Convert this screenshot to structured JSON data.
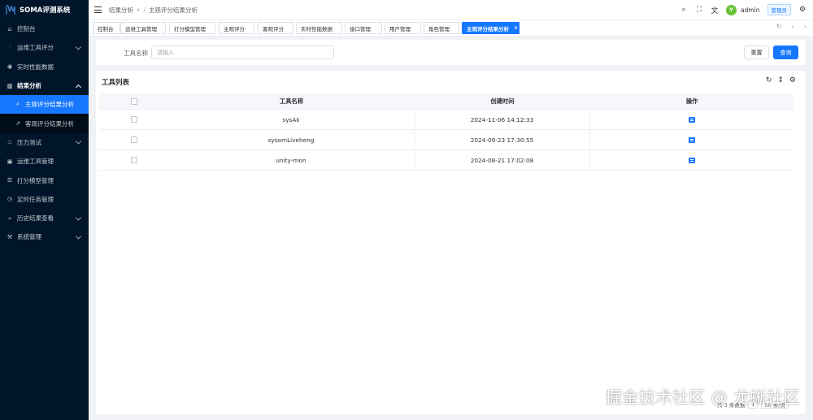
{
  "app": {
    "title": "SOMA评测系统"
  },
  "sidebar": {
    "items": [
      {
        "label": "控制台",
        "icon": "dashboard-icon"
      },
      {
        "label": "运维工具评分",
        "icon": "sliders-icon"
      },
      {
        "label": "实时性能数据",
        "icon": "gauge-icon"
      },
      {
        "label": "结果分析",
        "icon": "chart-icon"
      },
      {
        "label": "压力测试",
        "icon": "fire-icon"
      },
      {
        "label": "运维工具管理",
        "icon": "toolbox-icon"
      },
      {
        "label": "打分模型管理",
        "icon": "score-icon"
      },
      {
        "label": "定时任务管理",
        "icon": "clock-icon"
      },
      {
        "label": "历史结果查看",
        "icon": "history-icon"
      },
      {
        "label": "系统管理",
        "icon": "wrench-icon"
      }
    ],
    "submenu": [
      {
        "label": "主观评分结果分析",
        "icon": "search-doc-icon"
      },
      {
        "label": "客观评分结果分析",
        "icon": "trend-icon"
      }
    ]
  },
  "header": {
    "breadcrumb": [
      "结果分析",
      "主观评分结果分析"
    ],
    "username": "admin",
    "role": "管理员",
    "avatar_text": "Y"
  },
  "tabs": [
    "控制台",
    "运维工具管理",
    "打分模型管理",
    "主观评分",
    "客观评分",
    "实时性能数据",
    "接口管理",
    "用户管理",
    "角色管理",
    "主观评分结果分析"
  ],
  "search": {
    "label": "工具名称",
    "placeholder": "请输入",
    "reset": "重置",
    "query": "查询"
  },
  "table": {
    "title": "工具列表",
    "columns": [
      "工具名称",
      "创建时间",
      "操作"
    ],
    "rows": [
      {
        "name": "sysAk",
        "created": "2024-11-06 14:12:33"
      },
      {
        "name": "sysomLiveheng",
        "created": "2024-09-23 17:30:55"
      },
      {
        "name": "unity-mon",
        "created": "2024-08-21 17:02:08"
      }
    ]
  },
  "pagination": {
    "total_text": "共 3 条数据",
    "page": "1",
    "page_size": "50 条/页"
  },
  "watermark": "掘金技术社区 @ 龙蜥社区",
  "colors": {
    "primary": "#1677ff",
    "sidebar_bg": "#001529"
  }
}
